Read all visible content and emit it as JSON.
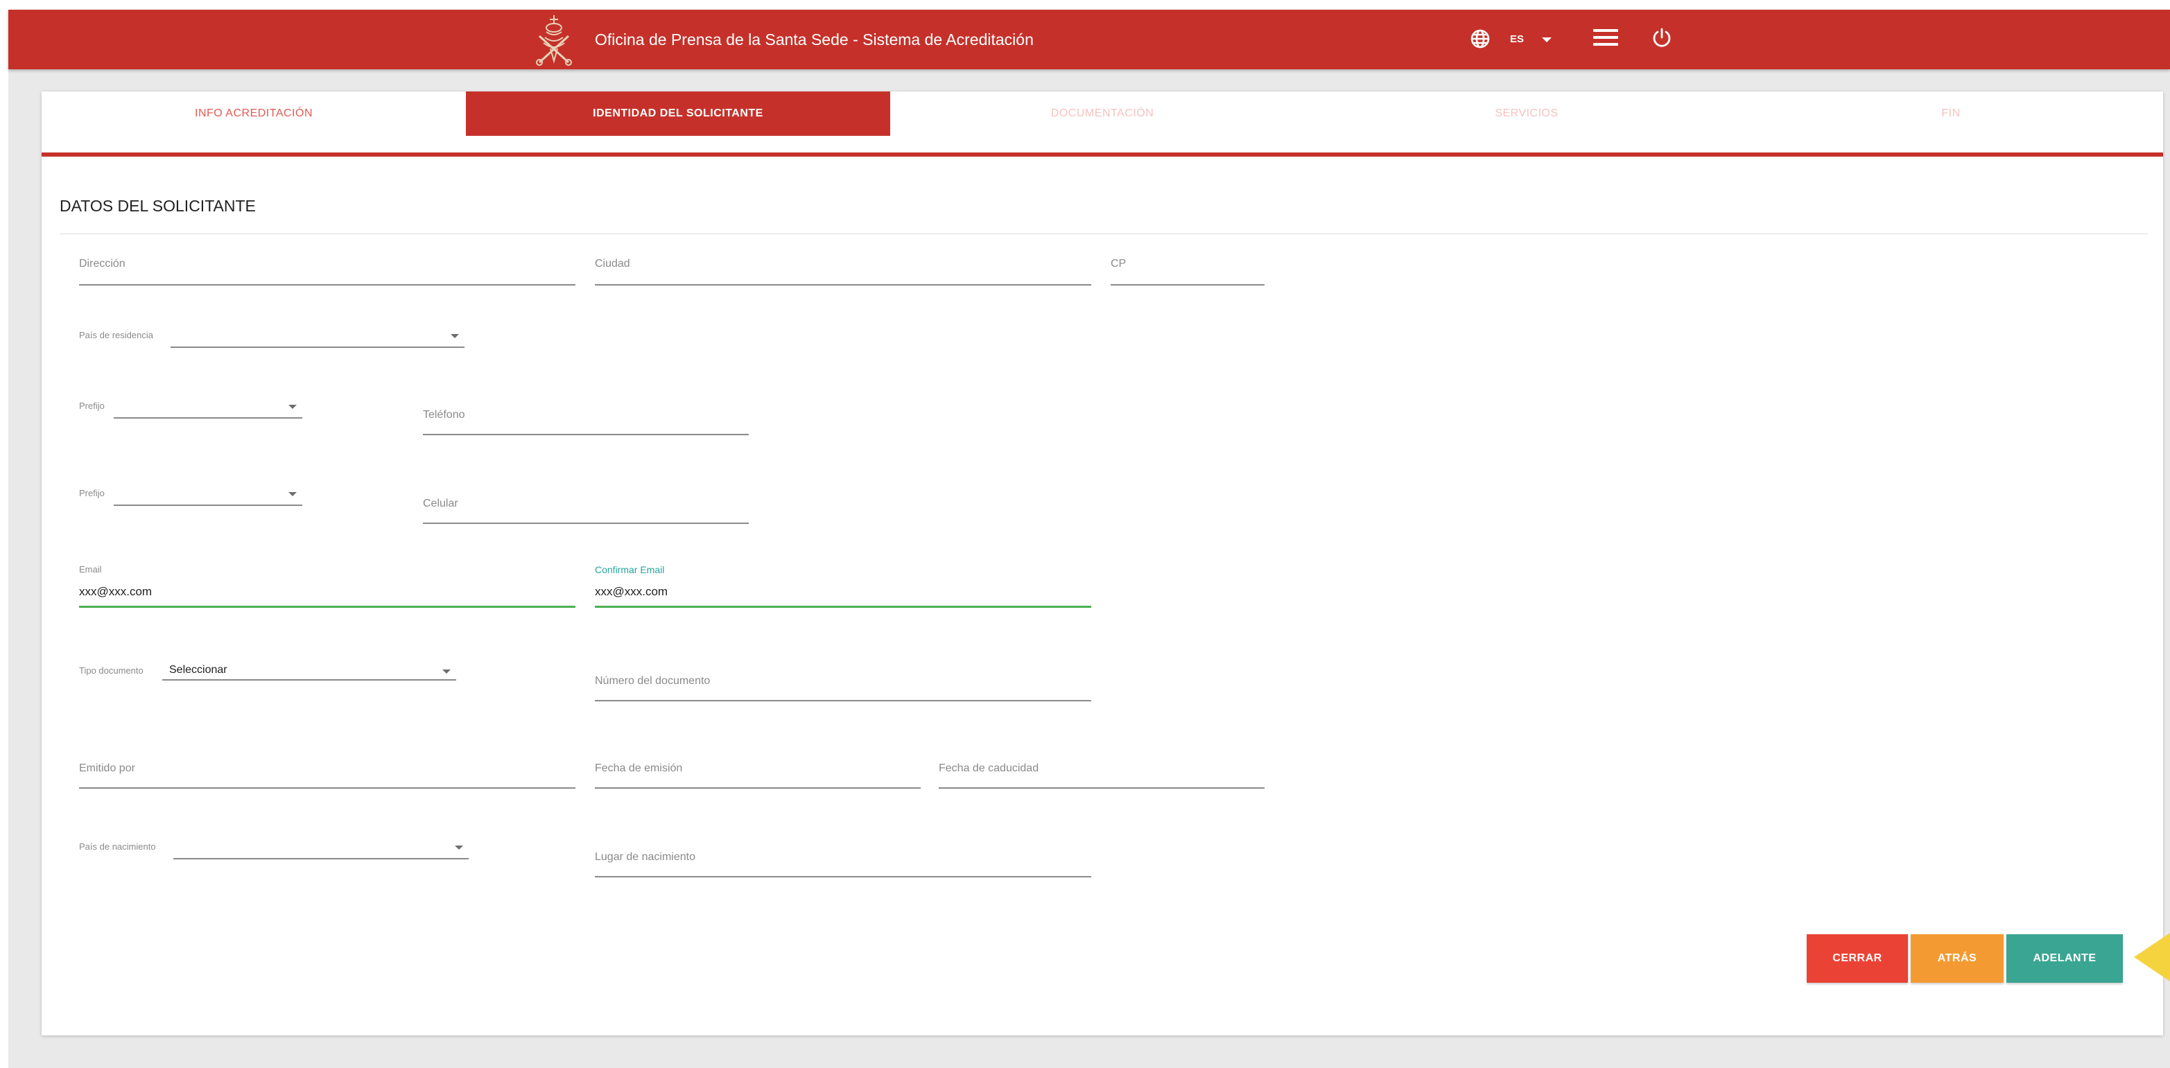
{
  "header": {
    "title": "Oficina de Prensa de la Santa Sede - Sistema de Acreditación",
    "language": "ES",
    "icons": [
      "papal-emblem-logo",
      "globe-icon",
      "chevron-down-icon",
      "menu-icon",
      "power-icon"
    ]
  },
  "steps": [
    {
      "label": "INFO ACREDITACIÓN",
      "state": "done"
    },
    {
      "label": "IDENTIDAD DEL SOLICITANTE",
      "state": "active"
    },
    {
      "label": "DOCUMENTACIÓN",
      "state": "todo"
    },
    {
      "label": "SERVICIOS",
      "state": "todo"
    },
    {
      "label": "FIN",
      "state": "todo"
    }
  ],
  "form": {
    "section_title": "DATOS DEL SOLICITANTE",
    "fields": {
      "direccion": {
        "label": "Dirección",
        "value": ""
      },
      "ciudad": {
        "label": "Ciudad",
        "value": ""
      },
      "cp": {
        "label": "CP",
        "value": ""
      },
      "pais_residencia": {
        "label": "País de residencia",
        "value": ""
      },
      "prefijo_telefono": {
        "label": "Prefijo",
        "value": ""
      },
      "telefono": {
        "label": "Teléfono",
        "value": ""
      },
      "prefijo_celular": {
        "label": "Prefijo",
        "value": ""
      },
      "celular": {
        "label": "Celular",
        "value": ""
      },
      "email": {
        "label": "Email",
        "value": "xxx@xxx.com"
      },
      "confirmar_email": {
        "label": "Confirmar Email",
        "value": "xxx@xxx.com"
      },
      "tipo_documento": {
        "label": "Tipo documento",
        "value": "Seleccionar"
      },
      "numero_documento": {
        "label": "Número del documento",
        "value": ""
      },
      "emitido_por": {
        "label": "Emitido por",
        "value": ""
      },
      "fecha_emision": {
        "label": "Fecha de emisión",
        "value": ""
      },
      "fecha_caducidad": {
        "label": "Fecha de caducidad",
        "value": ""
      },
      "pais_nacimiento": {
        "label": "País de nacimiento",
        "value": ""
      },
      "lugar_nacimiento": {
        "label": "Lugar de nacimiento",
        "value": ""
      }
    }
  },
  "buttons": {
    "close": "CERRAR",
    "back": "ATRÁS",
    "next": "ADELANTE"
  },
  "colors": {
    "brand_red": "#c5312a",
    "close_button": "#ea4335",
    "back_button": "#f39b32",
    "next_button": "#3aa592",
    "valid_green": "#4caf50",
    "focus_teal": "#26a69a",
    "cursor_yellow": "#f5d33f"
  }
}
